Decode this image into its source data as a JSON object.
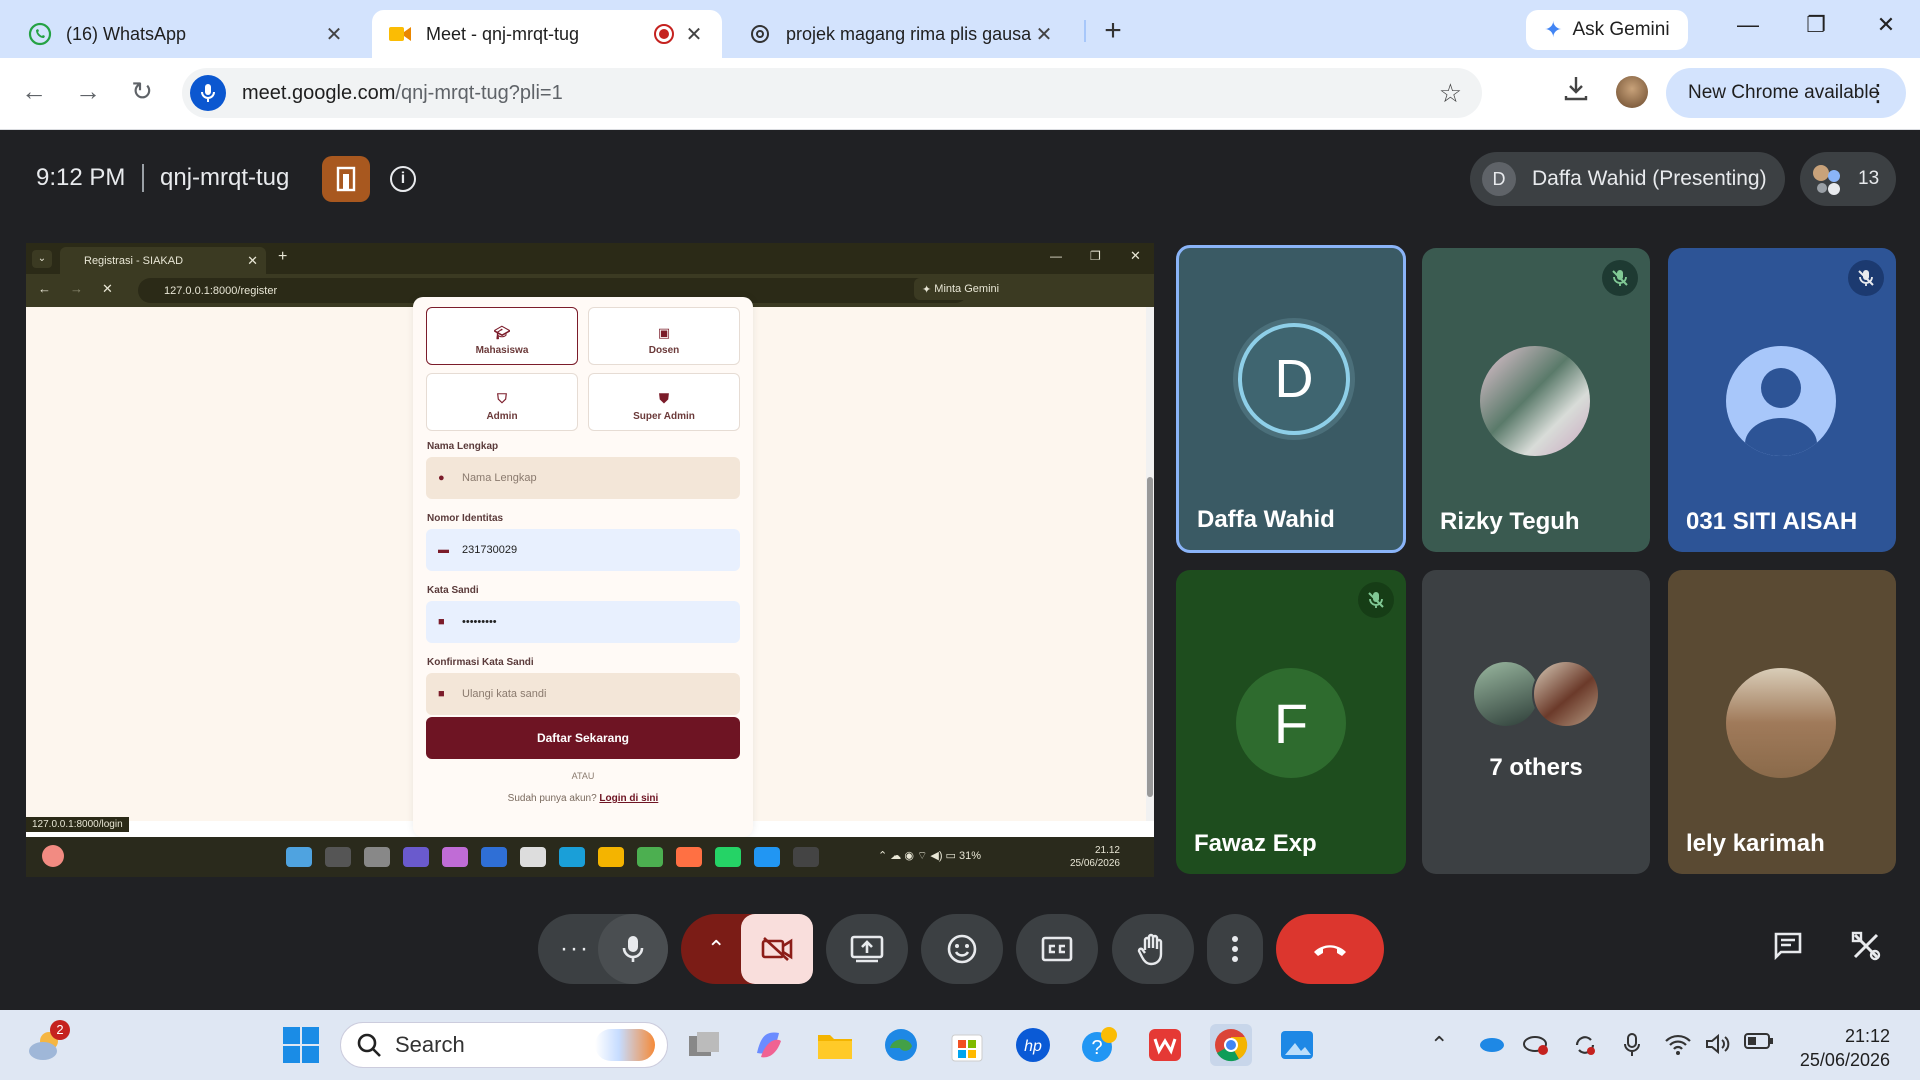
{
  "browser": {
    "tabs": [
      {
        "title": "(16) WhatsApp",
        "favicon": "whatsapp-icon"
      },
      {
        "title": "Meet - qnj-mrqt-tug",
        "favicon": "meet-icon",
        "recording": true
      },
      {
        "title": "projek magang rima plis gausa",
        "favicon": "chatgpt-icon"
      }
    ],
    "ask_gemini": "Ask Gemini",
    "url_main": "meet.google.com",
    "url_path": "/qnj-mrqt-tug?pli=1",
    "new_chrome": "New Chrome available"
  },
  "meet": {
    "time": "9:12 PM",
    "code": "qnj-mrqt-tug",
    "presenter_initial": "D",
    "presenting_label": "Daffa Wahid (Presenting)",
    "people_count": "13",
    "participants": [
      {
        "name": "Daffa Wahid",
        "initial": "D",
        "muted": false,
        "active_speaker": true
      },
      {
        "name": "Rizky Teguh",
        "muted": true
      },
      {
        "name": "031 SITI AISAH",
        "muted": true
      },
      {
        "name": "Fawaz Exp",
        "initial": "F",
        "muted": true
      },
      {
        "name": "7 others"
      },
      {
        "name": "lely karimah",
        "muted": false
      }
    ]
  },
  "shared_screen": {
    "tab_title": "Registrasi - SIAKAD",
    "gemini": "Minta Gemini",
    "url": "127.0.0.1:8000/register",
    "roles": [
      "Mahasiswa",
      "Dosen",
      "Admin",
      "Super Admin"
    ],
    "fields": [
      {
        "label": "Nama Lengkap",
        "placeholder": "Nama Lengkap",
        "value": ""
      },
      {
        "label": "Nomor Identitas",
        "placeholder": "",
        "value": "231730029"
      },
      {
        "label": "Kata Sandi",
        "placeholder": "",
        "value": "•••••••••"
      },
      {
        "label": "Konfirmasi Kata Sandi",
        "placeholder": "Ulangi kata sandi",
        "value": ""
      }
    ],
    "submit": "Daftar Sekarang",
    "atau": "ATAU",
    "have_account": "Sudah punya akun?",
    "login_link": "Login di sini",
    "status_url": "127.0.0.1:8000/login",
    "battery": "31%",
    "clock_time": "21.12",
    "clock_date": "25/06/2026"
  },
  "taskbar": {
    "weather_badge": "2",
    "search": "Search",
    "time": "21:12",
    "date": "25/06/2026"
  }
}
